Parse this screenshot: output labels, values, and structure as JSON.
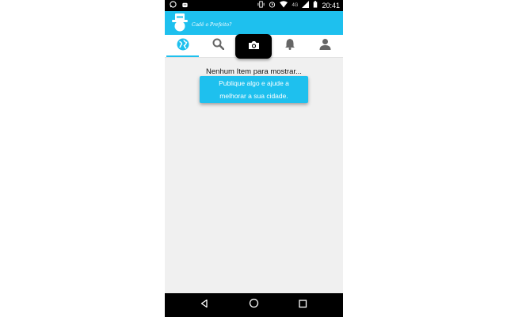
{
  "status_bar": {
    "network": "4G",
    "time": "20:41",
    "icons": [
      "whatsapp-icon",
      "android-icon",
      "vibrate-icon",
      "alarm-icon",
      "wifi-icon",
      "signal-icon",
      "battery-icon"
    ]
  },
  "app_bar": {
    "brand": "Cadê o Prefeito?",
    "logo": "mayor-hat-logo"
  },
  "tabs": [
    {
      "icon": "globe-icon",
      "active": true
    },
    {
      "icon": "search-icon",
      "active": false
    },
    {
      "icon": "camera-icon",
      "active": false
    },
    {
      "icon": "bell-icon",
      "active": false
    },
    {
      "icon": "person-icon",
      "active": false
    }
  ],
  "content": {
    "empty_message": "Nenhum Item para mostrar...",
    "cta_line1": "Publique algo e ajude a",
    "cta_line2": "melhorar a sua cidade."
  },
  "nav_bar": {
    "icons": [
      "back-icon",
      "home-icon",
      "recents-icon"
    ]
  },
  "colors": {
    "accent": "#1ec0ee",
    "background": "#f0f0f0"
  }
}
